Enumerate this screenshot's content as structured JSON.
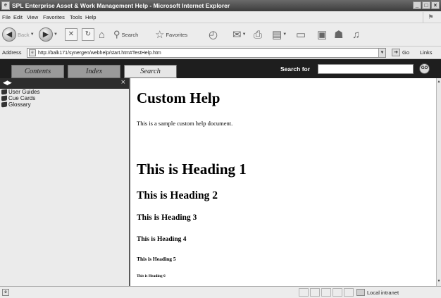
{
  "window": {
    "title": "SPL Enterprise Asset & Work Management Help - Microsoft Internet Explorer",
    "buttons": [
      "_",
      "□",
      "×"
    ]
  },
  "menu": [
    "File",
    "Edit",
    "View",
    "Favorites",
    "Tools",
    "Help"
  ],
  "toolbar": {
    "back_label": "Back",
    "search_label": "Search",
    "favorites_label": "Favorites"
  },
  "address": {
    "label": "Address",
    "url": "http://balk171/synergen/webhelp/start.htm#TestHelp.htm",
    "go_label": "Go",
    "links_label": "Links"
  },
  "helpbar": {
    "tabs": [
      "Contents",
      "Index",
      "Search"
    ],
    "search_for_label": "Search for",
    "go_label": "GO"
  },
  "nav": {
    "items": [
      "User Guides",
      "Cue Cards",
      "Glossary"
    ]
  },
  "content": {
    "title": "Custom Help",
    "intro": "This is a sample custom help document.",
    "h1": "This is Heading 1",
    "h2": "This is Heading 2",
    "h3": "This is Heading 3",
    "h4": "This is Heading 4",
    "h5": "This is Heading 5",
    "h6": "This is Heading 6"
  },
  "status": {
    "zone": "Local intranet"
  }
}
